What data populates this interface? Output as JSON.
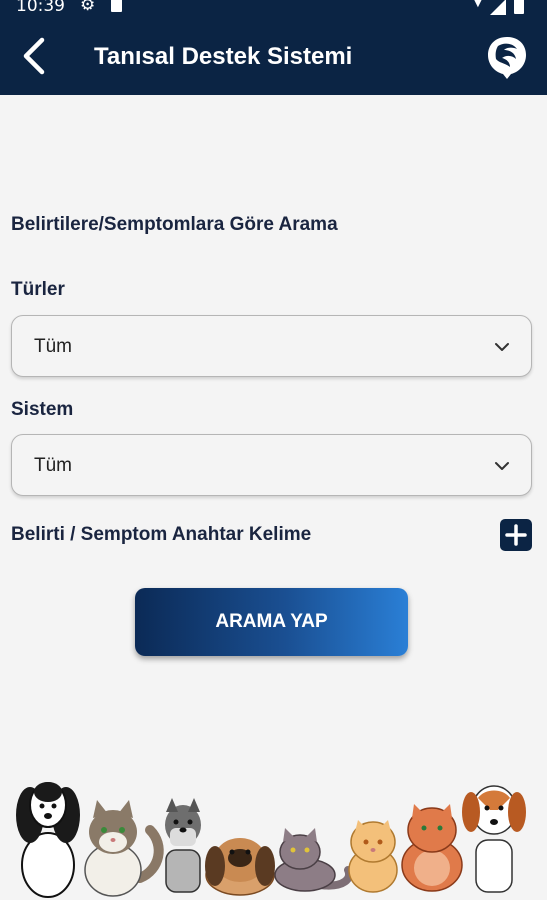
{
  "status_bar": {
    "time": "10:39"
  },
  "app_bar": {
    "title": "Tanısal Destek Sistemi"
  },
  "search": {
    "section_title": "Belirtilere/Semptomlara Göre Arama",
    "species_label": "Türler",
    "species_value": "Tüm",
    "system_label": "Sistem",
    "system_value": "Tüm",
    "keyword_label": "Belirti / Semptom Anahtar Kelime",
    "search_button": "ARAMA YAP"
  },
  "icons": {
    "back": "back-arrow-icon",
    "logo": "app-logo-icon",
    "chevron": "chevron-down-icon",
    "add": "plus-icon"
  },
  "colors": {
    "app_bar": "#0b2444",
    "button_start": "#0b2a56",
    "button_end": "#2a7fd6",
    "background": "#f4f4f4"
  }
}
